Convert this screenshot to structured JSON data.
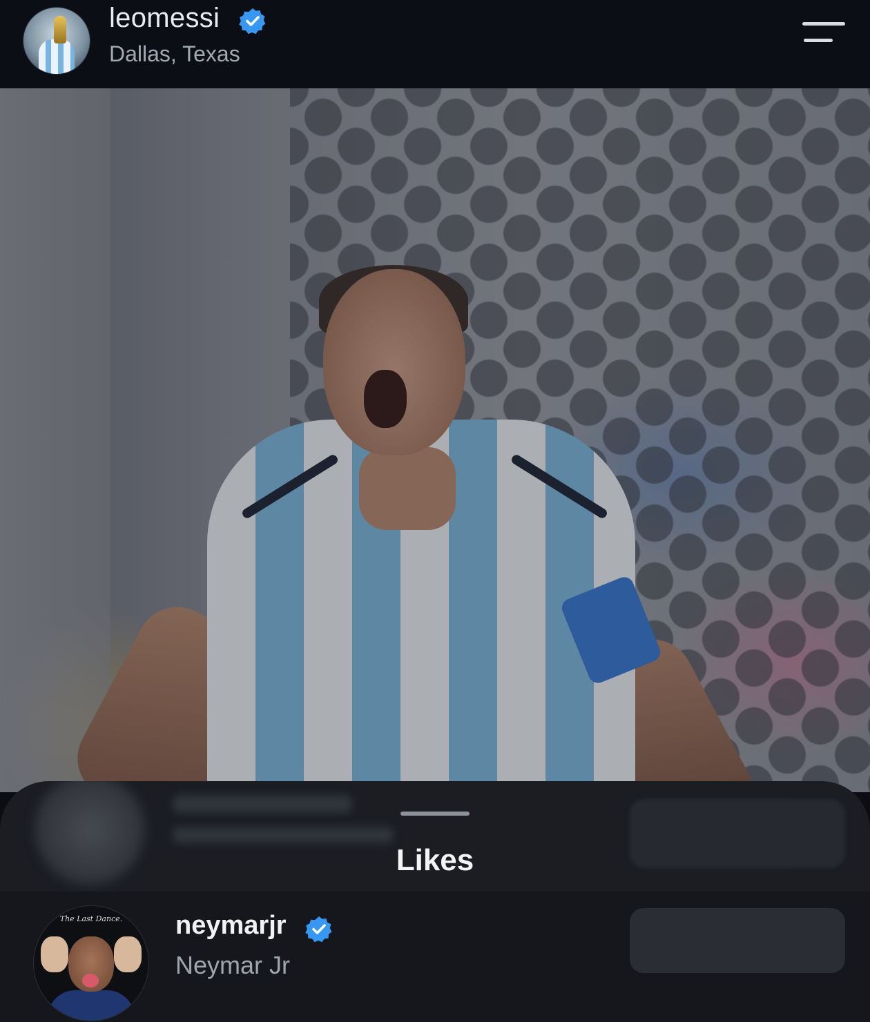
{
  "header": {
    "username": "leomessi",
    "location": "Dallas, Texas",
    "verified_icon": "verified-badge-icon",
    "menu_icon": "menu-icon"
  },
  "post": {
    "image_icon": "post-photo"
  },
  "likes_sheet": {
    "title": "Likes",
    "items": [
      {
        "username": "neymarjr",
        "full_name": "Neymar Jr",
        "avatar_caption": "The Last Dance.",
        "verified": true
      }
    ]
  },
  "colors": {
    "verified_blue": "#3897f0",
    "sheet_bg": "#1b1d23",
    "header_bg": "#0b0e14"
  }
}
